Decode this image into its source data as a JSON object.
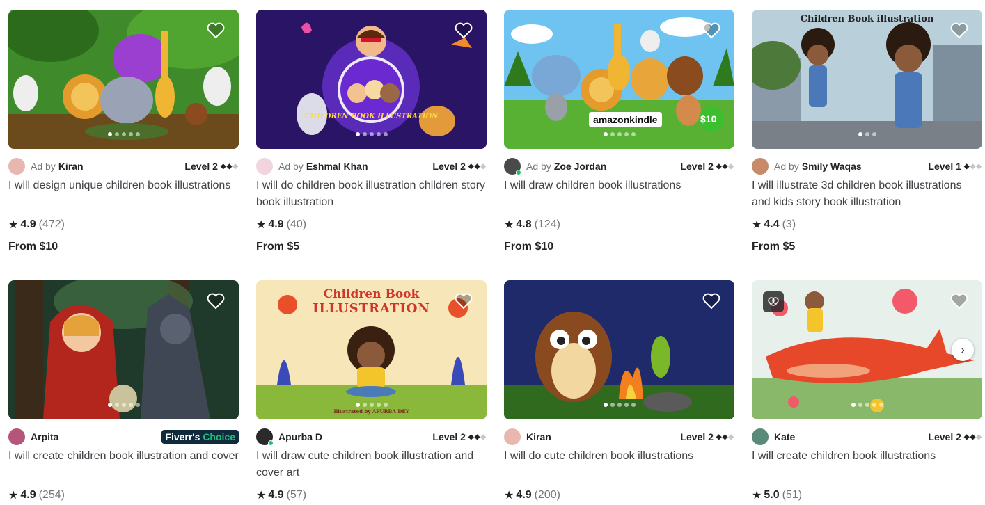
{
  "gigs": [
    {
      "ad_prefix": "Ad by",
      "seller": "Kiran",
      "level": "Level 2",
      "title": "I will design unique children book illustrations",
      "rating": "4.9",
      "count": "(472)",
      "price": "From $10"
    },
    {
      "ad_prefix": "Ad by",
      "seller": "Eshmal Khan",
      "level": "Level 2",
      "title": "I will do children book illustration children story book illustration",
      "rating": "4.9",
      "count": "(40)",
      "price": "From $5",
      "thumb_text": "CHILDREN BOOK ILLUSTRATION"
    },
    {
      "ad_prefix": "Ad by",
      "seller": "Zoe Jordan",
      "level": "Level 2",
      "title": "I will draw children book illustrations",
      "rating": "4.8",
      "count": "(124)",
      "price": "From $10",
      "thumb_text": "amazonkindle",
      "thumb_price": "$10"
    },
    {
      "ad_prefix": "Ad by",
      "seller": "Smily Waqas",
      "level": "Level 1",
      "title": "I will illustrate 3d children book illustrations and kids story book illustration",
      "rating": "4.4",
      "count": "(3)",
      "price": "From $5",
      "thumb_text": "Children Book illustration"
    },
    {
      "seller": "Arpita",
      "badge_main": "Fiverr's",
      "badge_accent": "Choice",
      "title": "I will create children book illustration and cover",
      "rating": "4.9",
      "count": "(254)"
    },
    {
      "seller": "Apurba D",
      "level": "Level 2",
      "title": "I will draw cute children book illustration and cover art",
      "rating": "4.9",
      "count": "(57)",
      "thumb_title_1": "Children Book",
      "thumb_title_2": "ILLUSTRATION",
      "thumb_credit": "Illustrated by APURBA DEY"
    },
    {
      "seller": "Kiran",
      "level": "Level 2",
      "title": "I will do cute children book illustrations",
      "rating": "4.9",
      "count": "(200)"
    },
    {
      "seller": "Kate",
      "level": "Level 2",
      "title": "I will create children book illustrations",
      "rating": "5.0",
      "count": "(51)"
    }
  ],
  "icons": {
    "heart": "heart-icon",
    "star": "star-icon",
    "next": "chevron-right-icon",
    "ai": "ai-brain-icon"
  },
  "colors": {
    "online": "#1dbf73",
    "badge_bg": "#0e2a3c",
    "text": "#404145",
    "muted": "#74767e"
  }
}
